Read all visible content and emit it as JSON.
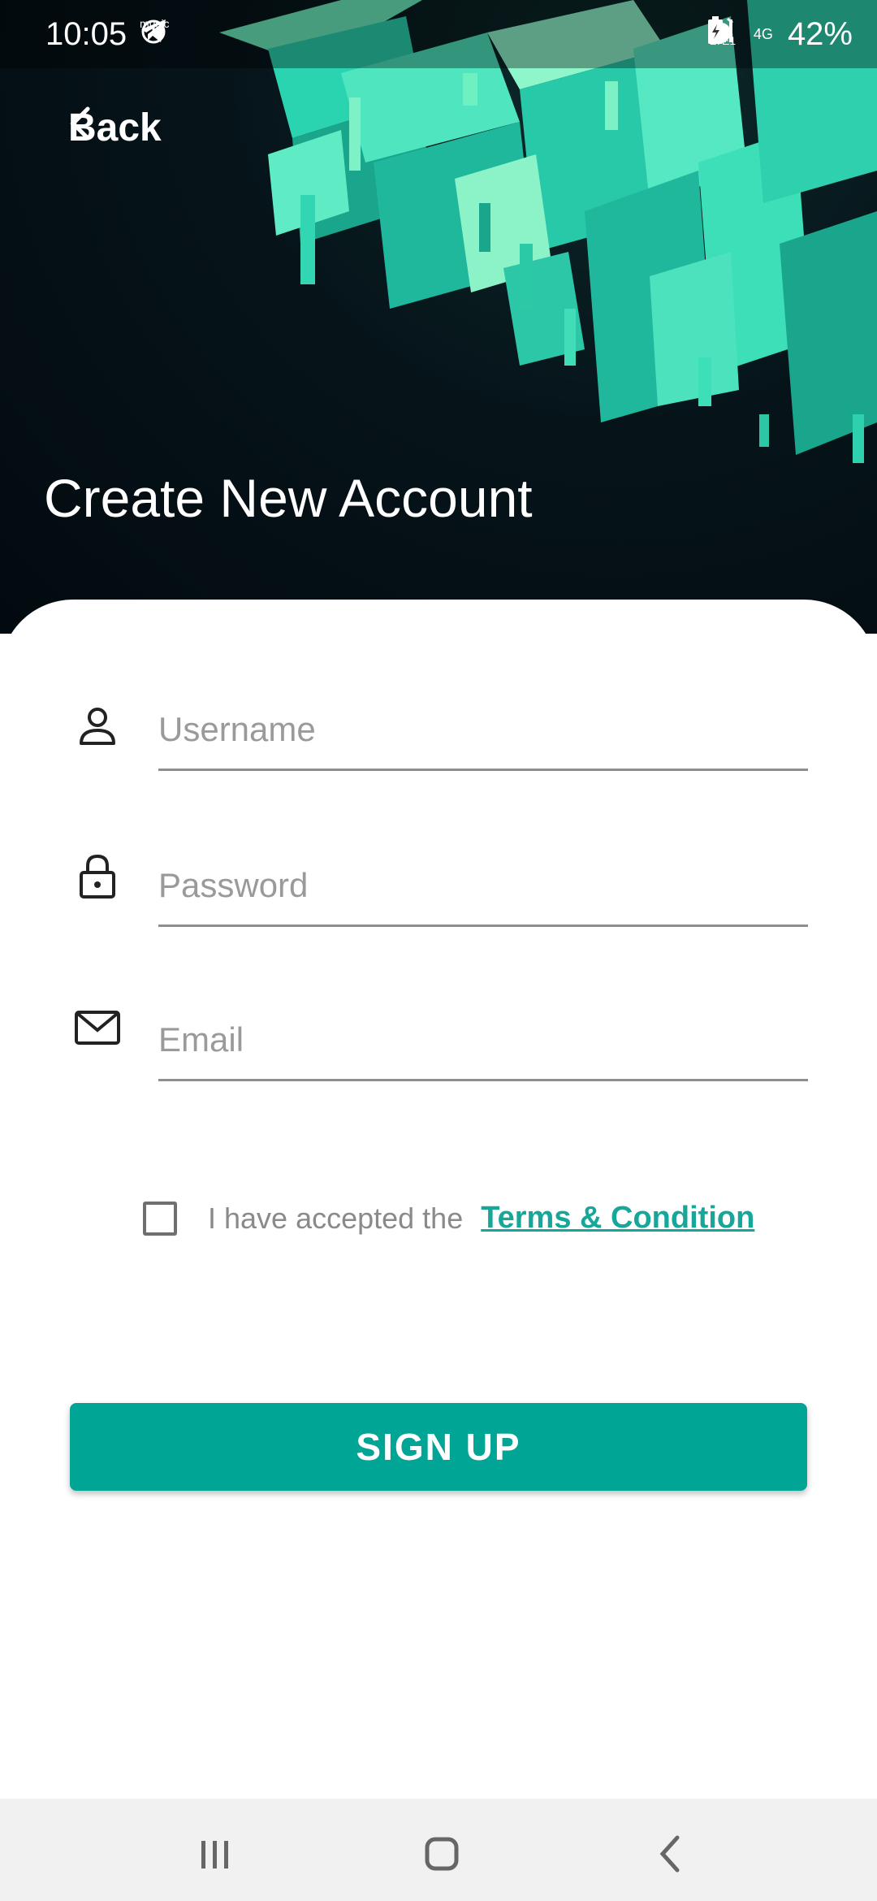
{
  "status_bar": {
    "time": "10:05",
    "music_label": "music",
    "volte_label": "Vo)) LTE1",
    "network_label": "4G",
    "battery": "42%"
  },
  "header": {
    "back_label": "Back",
    "title": "Create New Account"
  },
  "form": {
    "username_placeholder": "Username",
    "password_placeholder": "Password",
    "email_placeholder": "Email"
  },
  "terms": {
    "text": "I have accepted the",
    "link": "Terms & Condition"
  },
  "signup_label": "SIGN UP",
  "colors": {
    "accent": "#00a595",
    "link": "#16a79a",
    "hero_dark": "#020a0f",
    "hero_teal": "#3ee0b8"
  },
  "icons": {
    "username": "person-icon",
    "password": "lock-icon",
    "email": "mail-icon"
  }
}
